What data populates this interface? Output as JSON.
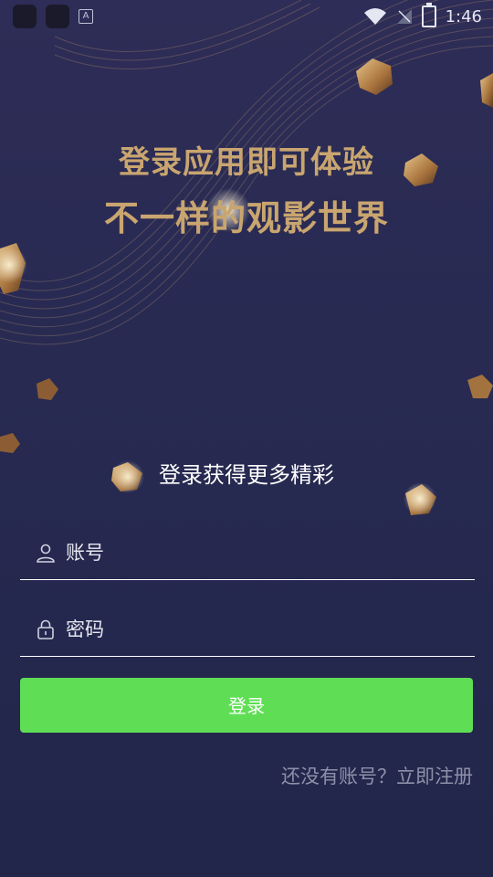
{
  "status_bar": {
    "time": "1:46",
    "icons": [
      "app-icon",
      "app-icon",
      "a-icon",
      "wifi-icon",
      "no-signal-icon",
      "battery-charging-icon"
    ]
  },
  "hero": {
    "line1": "登录应用即可体验",
    "line2": "不一样的观影世界"
  },
  "login": {
    "subtitle": "登录获得更多精彩",
    "account_placeholder": "账号",
    "password_placeholder": "密码",
    "submit_label": "登录",
    "register_prompt": "还没有账号？立即注册"
  },
  "colors": {
    "background": "#282a52",
    "headline_gold": "#c9a56f",
    "button_green": "#5fde55",
    "link_gray": "#8e90a9"
  }
}
